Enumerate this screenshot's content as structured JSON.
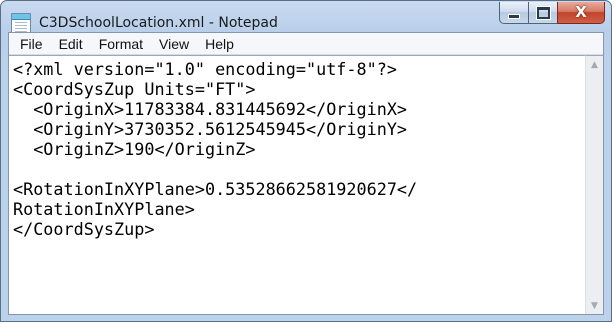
{
  "window": {
    "title": "C3DSchoolLocation.xml - Notepad"
  },
  "caption": {
    "close_glyph": "X"
  },
  "menu": {
    "items": [
      {
        "label": "File"
      },
      {
        "label": "Edit"
      },
      {
        "label": "Format"
      },
      {
        "label": "View"
      },
      {
        "label": "Help"
      }
    ]
  },
  "editor": {
    "content": "<?xml version=\"1.0\" encoding=\"utf-8\"?>\n<CoordSysZup Units=\"FT\">\n  <OriginX>11783384.831445692</OriginX>\n  <OriginY>3730352.5612545945</OriginY>\n  <OriginZ>190</OriginZ>\n\n<RotationInXYPlane>0.53528662581920627</\nRotationInXYPlane>\n</CoordSysZup>"
  },
  "scrollbar": {
    "up_glyph": "▲",
    "down_glyph": "▼"
  }
}
